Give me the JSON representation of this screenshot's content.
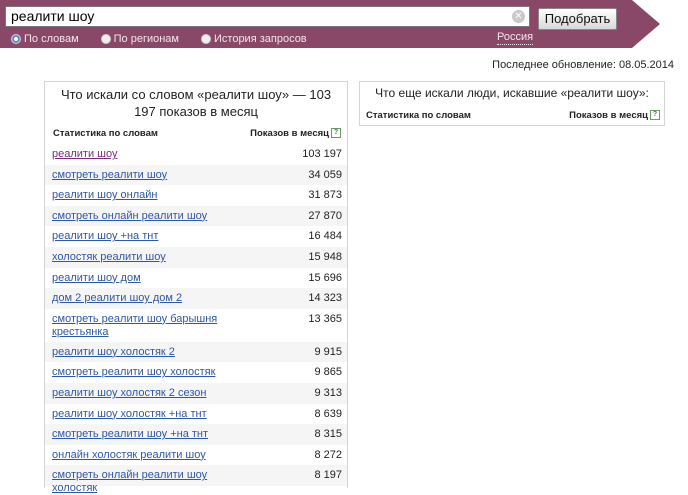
{
  "search": {
    "query": "реалити шоу",
    "submit_label": "Подобрать"
  },
  "modes": [
    {
      "label": "По словам",
      "selected": true
    },
    {
      "label": "По регионам",
      "selected": false
    },
    {
      "label": "История запросов",
      "selected": false
    }
  ],
  "region": "Россия",
  "last_update": "Последнее обновление: 08.05.2014",
  "left": {
    "title": "Что искали со словом «реалити шоу» — 103 197 показов в месяц",
    "col_phrase": "Статистика по словам",
    "col_count": "Показов в месяц",
    "rows": [
      {
        "phrase": "реалити шоу",
        "count": "103 197"
      },
      {
        "phrase": "смотреть реалити шоу",
        "count": "34 059"
      },
      {
        "phrase": "реалити шоу онлайн",
        "count": "31 873"
      },
      {
        "phrase": "смотреть онлайн реалити шоу",
        "count": "27 870"
      },
      {
        "phrase": "реалити шоу +на тнт",
        "count": "16 484"
      },
      {
        "phrase": "холостяк реалити шоу",
        "count": "15 948"
      },
      {
        "phrase": "реалити шоу дом",
        "count": "15 696"
      },
      {
        "phrase": "дом 2 реалити шоу дом 2",
        "count": "14 323"
      },
      {
        "phrase": "смотреть реалити шоу барышня крестьянка",
        "count": "13 365"
      },
      {
        "phrase": "реалити шоу холостяк 2",
        "count": "9 915"
      },
      {
        "phrase": "смотреть реалити шоу холостяк",
        "count": "9 865"
      },
      {
        "phrase": "реалити шоу холостяк 2 сезон",
        "count": "9 313"
      },
      {
        "phrase": "реалити шоу холостяк +на тнт",
        "count": "8 639"
      },
      {
        "phrase": "смотреть реалити шоу +на тнт",
        "count": "8 315"
      },
      {
        "phrase": "онлайн холостяк реалити шоу",
        "count": "8 272"
      },
      {
        "phrase": "смотреть онлайн реалити шоу холостяк",
        "count": "8 197"
      }
    ]
  },
  "right": {
    "title": "Что еще искали люди, искавшие «реалити шоу»:",
    "col_phrase": "Статистика по словам",
    "col_count": "Показов в месяц"
  },
  "icons": {
    "clear": "clear-icon",
    "help": "help-icon",
    "radio": "radio-icon"
  },
  "colors": {
    "band": "#8a4869",
    "link": "#2d57a8",
    "visited": "#7a2a7a"
  }
}
